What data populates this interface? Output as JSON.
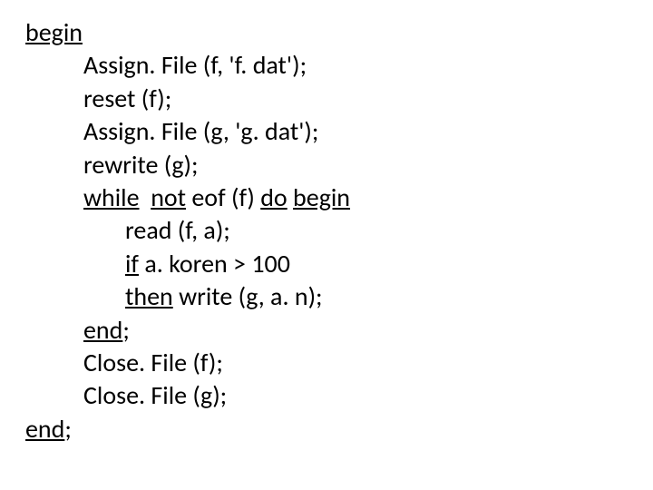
{
  "code": {
    "l1_kw": "begin",
    "l2": "Assign. File (f, 'f. dat');",
    "l3": "reset (f);",
    "l4": "Assign. File (g, 'g. dat');",
    "l5": "rewrite (g);",
    "l6_while": "while",
    "l6_sp1": "  ",
    "l6_not": "not",
    "l6_mid": " eof (f) ",
    "l6_do": "do",
    "l6_sp2": " ",
    "l6_begin": "begin",
    "l7": "read (f, a);",
    "l8_if": "if",
    "l8_rest": " a. koren > 100",
    "l9_then": "then",
    "l9_rest": " write (g, a. n);",
    "l10_end": "end",
    "l10_semi": ";",
    "l11": "Close. File (f);",
    "l12": "Close. File (g);",
    "l13_end": "end",
    "l13_semi": ";"
  }
}
